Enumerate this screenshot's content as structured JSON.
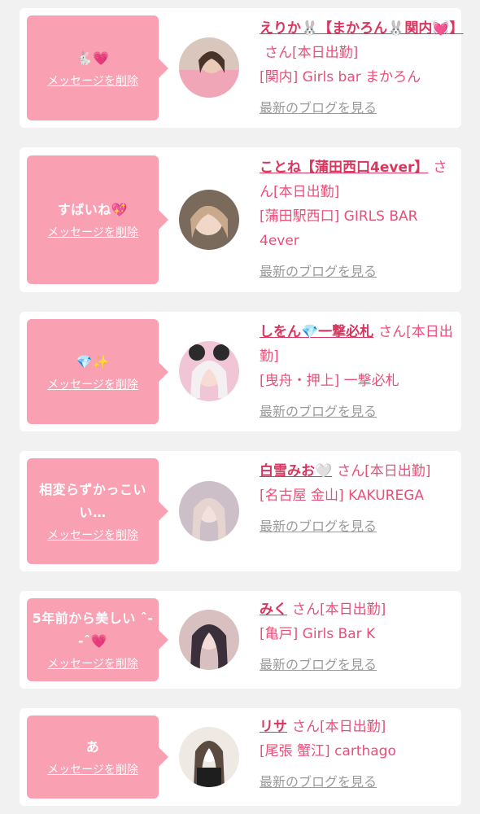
{
  "cards": [
    {
      "message": "🐇💗",
      "delete_label": "メッセージを削除",
      "name": "えりか🐰【まかろん🐰関内💓】",
      "san_status": "さん[本日出勤]",
      "shop": "[関内] Girls bar まかろん",
      "blog_label": "最新のブログを見る",
      "avatar_colors": [
        "#d9c7bd",
        "#f0a6b6"
      ]
    },
    {
      "message": "すばいね💖",
      "delete_label": "メッセージを削除",
      "name": "ことね【蒲田西口4ever】",
      "san_status": "さん[本日出勤]",
      "shop": "[蒲田駅西口] GIRLS BAR 4ever",
      "blog_label": "最新のブログを見る",
      "avatar_colors": [
        "#c9a98b",
        "#6b5a4b"
      ]
    },
    {
      "message": "💎✨",
      "delete_label": "メッセージを削除",
      "name": "しをん💎一撃必札",
      "san_status": "さん[本日出勤]",
      "shop": "[曳舟・押上] 一撃必札",
      "blog_label": "最新のブログを見る",
      "avatar_colors": [
        "#f0c6d6",
        "#2b2b2b"
      ]
    },
    {
      "message": "相変らずかっこいい…",
      "delete_label": "メッセージを削除",
      "name": "白雪みお🤍",
      "san_status": "さん[本日出勤]",
      "shop": "[名古屋 金山] KAKUREGA",
      "blog_label": "最新のブログを見る",
      "avatar_colors": [
        "#cdbfc8",
        "#e6d4d0"
      ]
    },
    {
      "message": "5年前から美しい ˆ- -ˆ💗",
      "delete_label": "メッセージを削除",
      "name": "みく",
      "san_status": "さん[本日出勤]",
      "shop": "[亀戸] Girls Bar K",
      "blog_label": "最新のブログを見る",
      "avatar_colors": [
        "#3a2f3a",
        "#d9c0c0"
      ]
    },
    {
      "message": "あ",
      "delete_label": "メッセージを削除",
      "name": "リサ",
      "san_status": "さん[本日出勤]",
      "shop": "[尾張 蟹江] carthago",
      "blog_label": "最新のブログを見る",
      "avatar_colors": [
        "#efe9e4",
        "#1e1e1e"
      ]
    }
  ]
}
